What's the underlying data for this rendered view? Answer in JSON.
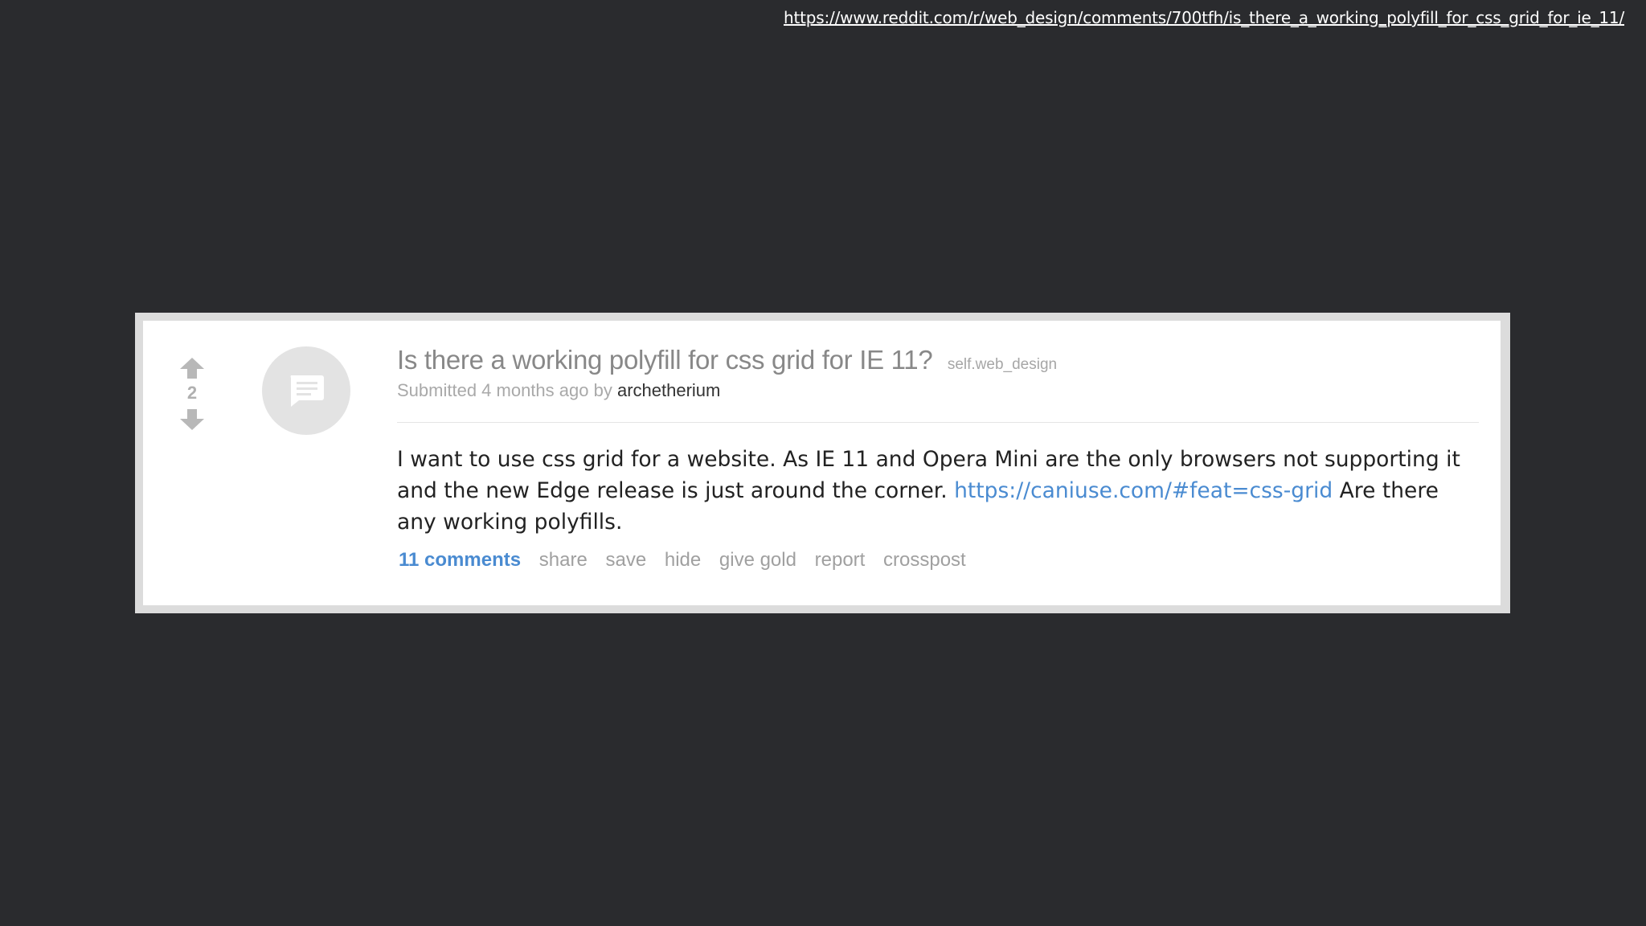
{
  "source_url": "https://www.reddit.com/r/web_design/comments/700tfh/is_there_a_working_polyfill_for_css_grid_for_ie_11/",
  "post": {
    "score": "2",
    "thumbnail_icon": "chat-bubble-icon",
    "title": "Is there a working polyfill for css grid for IE 11?",
    "domain": "self.web_design",
    "submitted_prefix": "Submitted 4 months ago by",
    "author": "archetherium",
    "body_text_1": "I want to use css grid for a website. As IE 11 and Opera Mini are the only browsers not supporting it and the new Edge release is just around the corner.",
    "body_link": "https://caniuse.com/#feat=css-grid",
    "body_text_2": "Are there any working polyfills.",
    "buttons": {
      "comments": "11 comments",
      "share": "share",
      "save": "save",
      "hide": "hide",
      "give_gold": "give gold",
      "report": "report",
      "crosspost": "crosspost"
    }
  },
  "colors": {
    "background": "#2a2b2e",
    "link_blue": "#4a8bd1",
    "muted_gray": "#a0a0a0"
  }
}
